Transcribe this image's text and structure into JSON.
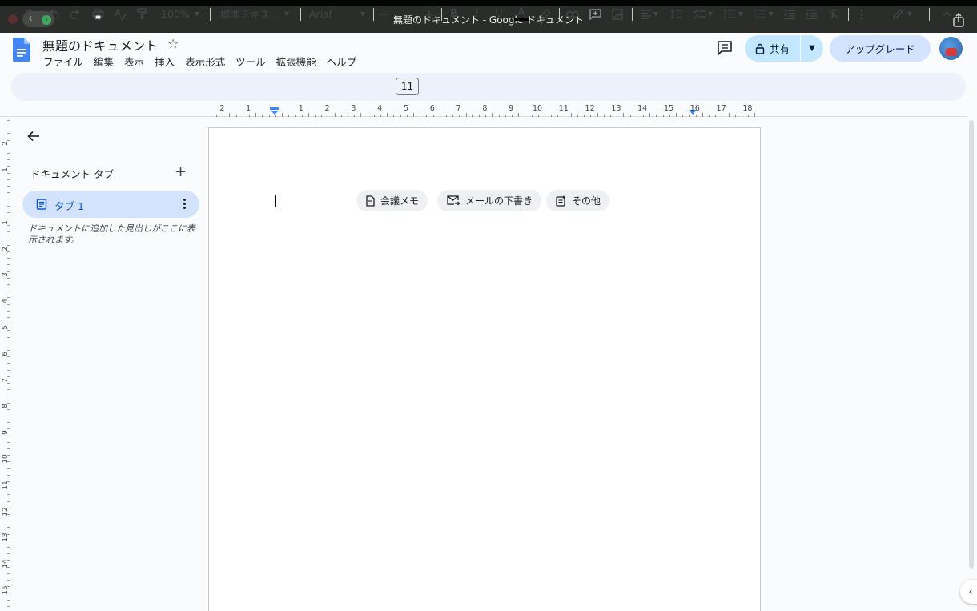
{
  "window": {
    "title": "無題のドキュメント - Google ドキュメント"
  },
  "header": {
    "doc_title": "無題のドキュメント",
    "menus": [
      "ファイル",
      "編集",
      "表示",
      "挿入",
      "表示形式",
      "ツール",
      "拡張機能",
      "ヘルプ"
    ],
    "share_label": "共有",
    "upgrade_label": "アップグレード"
  },
  "toolbar": {
    "zoom": "100%",
    "style": "標準テキス...",
    "font": "Arial",
    "font_size": "11",
    "bold": "B",
    "italic": "I",
    "underline": "U",
    "text_color": "A"
  },
  "ruler": {
    "h_labels": [
      "2",
      "1",
      "1",
      "2",
      "3",
      "4",
      "5",
      "6",
      "7",
      "8",
      "9",
      "10",
      "11",
      "12",
      "13",
      "14",
      "15",
      "16",
      "17",
      "18"
    ],
    "v_labels": [
      "2",
      "1",
      "1",
      "2",
      "3",
      "4",
      "5",
      "6",
      "7",
      "8",
      "9",
      "10",
      "11",
      "12",
      "13",
      "14",
      "15"
    ]
  },
  "sidebar": {
    "heading": "ドキュメント タブ",
    "tabs": [
      {
        "label": "タブ 1"
      }
    ],
    "outline_hint": "ドキュメントに追加した見出しがここに表示されます。"
  },
  "chips": [
    {
      "label": "会議メモ",
      "icon": "doc-icon"
    },
    {
      "label": "メールの下書き",
      "icon": "email-draft-icon"
    },
    {
      "label": "その他",
      "icon": "more-templates-icon"
    }
  ],
  "colors": {
    "accent": "#0b57d0",
    "share_bg": "#c2e7ff",
    "upgrade_bg": "#d3e3fd",
    "toolbar_bg": "#edf2fa",
    "docs_blue": "#4285f4"
  }
}
